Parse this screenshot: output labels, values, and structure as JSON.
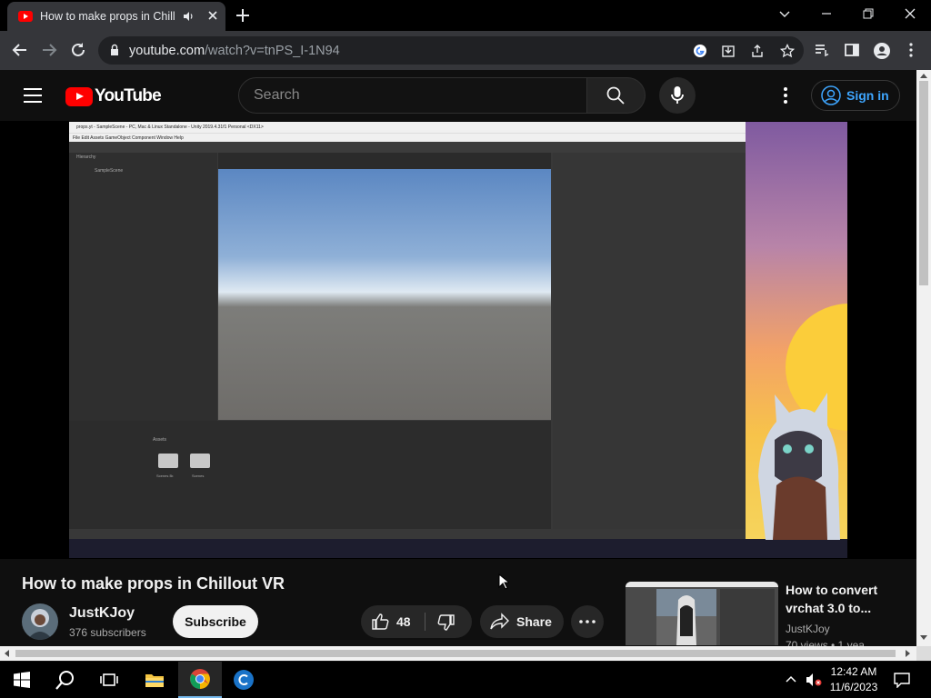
{
  "browser": {
    "tab_title": "How to make props in Chillout VR",
    "url_host": "youtube.com",
    "url_path": "/watch?v=tnPS_I-1N94"
  },
  "youtube": {
    "logo_text": "YouTube",
    "search_placeholder": "Search",
    "signin_label": "Sign in"
  },
  "video": {
    "title": "How to make props in Chillout VR",
    "channel": "JustKJoy",
    "subscribers": "376 subscribers",
    "subscribe_label": "Subscribe",
    "likes": "48",
    "share_label": "Share"
  },
  "embedded_screen": {
    "window_title": "props.yt - SampleScene - PC, Mac & Linux Standalone - Unity 2019.4.31f1 Personal <DX11>",
    "menu": "File   Edit   Assets   GameObject   Component   Window   Help",
    "hierarchy_label": "Hierarchy",
    "scene_item": "SampleScene",
    "assets_label": "Assets",
    "folder_1": "Scenes Br.",
    "folder_2": "Scenes"
  },
  "recommended": {
    "title": "How to convert vrchat 3.0 to...",
    "channel": "JustKJoy",
    "meta": "70 views  •  1 yea"
  },
  "taskbar": {
    "time": "12:42 AM",
    "date": "11/6/2023"
  },
  "colors": {
    "accent_blue": "#3ea6ff",
    "youtube_red": "#ff0000",
    "page_bg": "#0f0f0f"
  }
}
